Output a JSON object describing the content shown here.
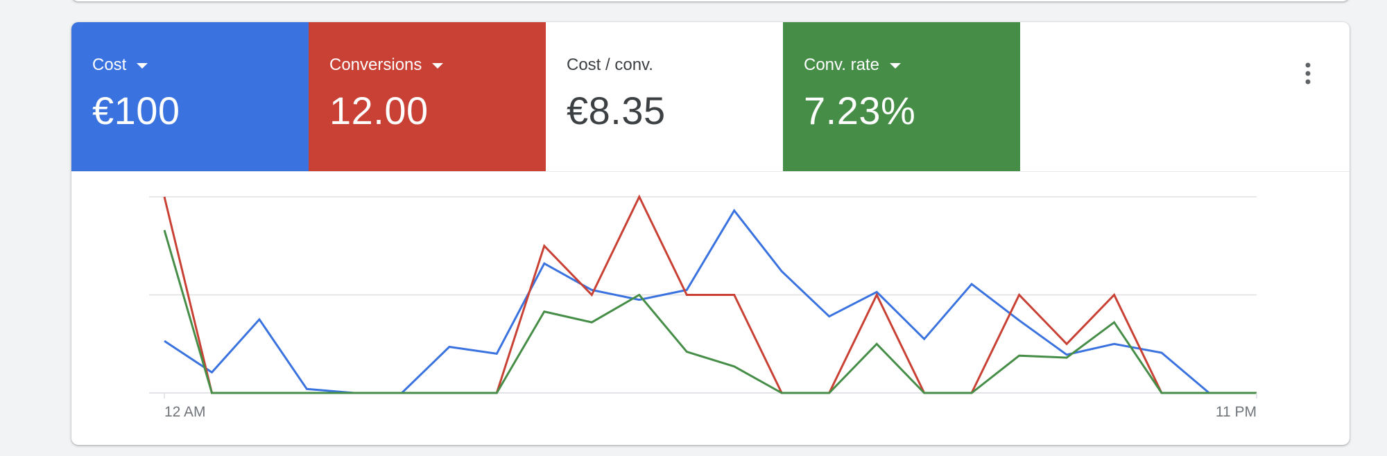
{
  "metrics": [
    {
      "label": "Cost",
      "value": "€100",
      "dropdown": true,
      "active": true,
      "color": "#3a73e0"
    },
    {
      "label": "Conversions",
      "value": "12.00",
      "dropdown": true,
      "active": true,
      "color": "#c94034"
    },
    {
      "label": "Cost / conv.",
      "value": "€8.35",
      "dropdown": false,
      "active": false,
      "color": "#ffffff"
    },
    {
      "label": "Conv. rate",
      "value": "7.23%",
      "dropdown": true,
      "active": true,
      "color": "#468e48"
    }
  ],
  "menu": {
    "icon": "more-vert-icon"
  },
  "chart_data": {
    "type": "line",
    "x": [
      "12 AM",
      "1 AM",
      "2 AM",
      "3 AM",
      "4 AM",
      "5 AM",
      "6 AM",
      "7 AM",
      "8 AM",
      "9 AM",
      "10 AM",
      "11 AM",
      "12 PM",
      "1 PM",
      "2 PM",
      "3 PM",
      "4 PM",
      "5 PM",
      "6 PM",
      "7 PM",
      "8 PM",
      "9 PM",
      "10 PM",
      "11 PM"
    ],
    "x_tick_labels": [
      "12 AM",
      "11 PM"
    ],
    "ylim": [
      0,
      2
    ],
    "grid": true,
    "legend": "none",
    "series": [
      {
        "key": "cost",
        "color": "#3a73e0",
        "values": [
          0.53,
          0.21,
          0.75,
          0.04,
          0.0,
          0.0,
          0.47,
          0.4,
          1.32,
          1.05,
          0.95,
          1.05,
          1.86,
          1.24,
          0.78,
          1.03,
          0.55,
          1.11,
          0.74,
          0.39,
          0.5,
          0.41,
          0.0,
          0.0
        ]
      },
      {
        "key": "conversions",
        "color": "#c94034",
        "values": [
          2.0,
          0.0,
          0.0,
          0.0,
          0.0,
          0.0,
          0.0,
          0.0,
          1.5,
          1.0,
          2.0,
          1.0,
          1.0,
          0.0,
          0.0,
          1.0,
          0.0,
          0.0,
          1.0,
          0.5,
          1.0,
          0.0,
          0.0,
          0.0
        ]
      },
      {
        "key": "conv_rate",
        "color": "#468e48",
        "values": [
          1.66,
          0.0,
          0.0,
          0.0,
          0.0,
          0.0,
          0.0,
          0.0,
          0.83,
          0.72,
          1.0,
          0.42,
          0.27,
          0.0,
          0.0,
          0.5,
          0.0,
          0.0,
          0.38,
          0.36,
          0.72,
          0.0,
          0.0,
          0.0
        ]
      }
    ]
  }
}
